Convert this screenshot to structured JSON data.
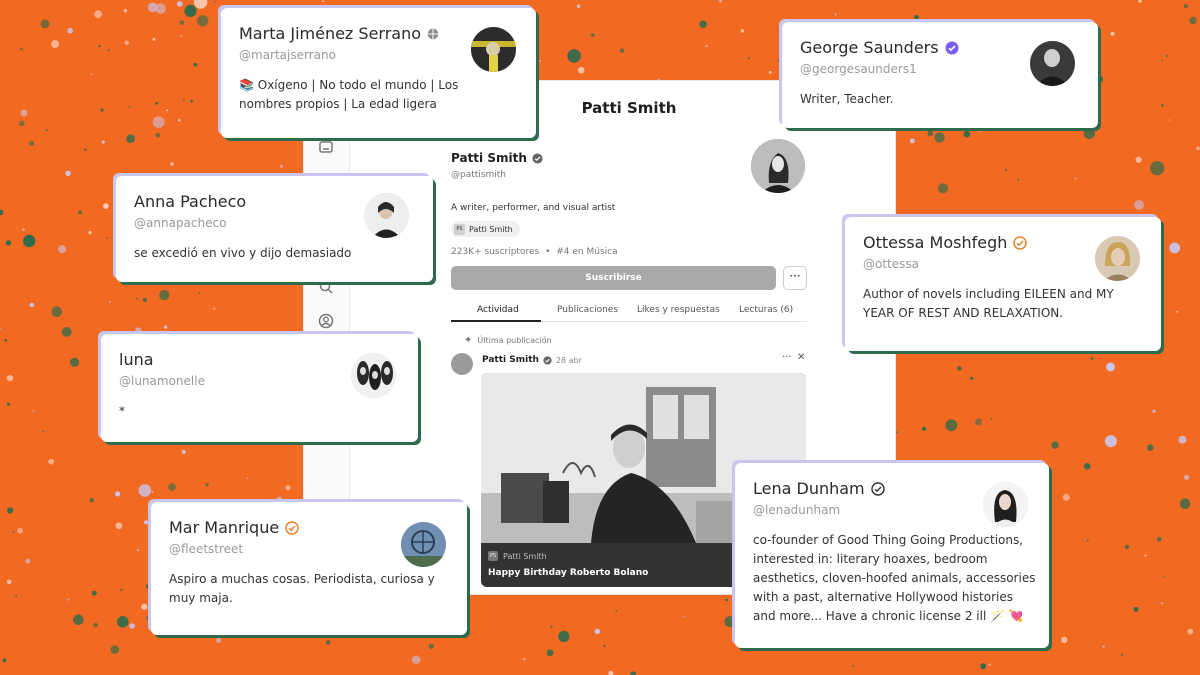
{
  "profile": {
    "title": "Patti Smith",
    "name": "Patti Smith",
    "handle": "@pattismith",
    "bio": "A writer, performer, and visual artist",
    "chip_label": "Patti Smith",
    "chip_initials": "PS",
    "subscribers": "223K+ suscriptores",
    "rank": "#4 en Música",
    "subscribe_label": "Suscribirse",
    "more_label": "···",
    "tabs": [
      "Actividad",
      "Publicaciones",
      "Likes y respuestas",
      "Lecturas (6)"
    ],
    "latest_label": "Última publicación",
    "post": {
      "author": "Patti Smith",
      "date": "28 abr",
      "source_initials": "PS",
      "source": "Patti Smith",
      "title": "Happy Birthday Roberto Bolano"
    }
  },
  "cards": [
    {
      "name": "Marta Jiménez Serrano",
      "handle": "@martajserrano",
      "bio": "📚 Oxígeno | No todo el mundo | Los nombres propios | La edad ligera",
      "badge": "globe-icon"
    },
    {
      "name": "George Saunders",
      "handle": "@georgesaunders1",
      "bio": "Writer, Teacher.",
      "badge": "verified-purple-icon"
    },
    {
      "name": "Anna Pacheco",
      "handle": "@annapacheco",
      "bio": "se excedió en vivo y dijo demasiado",
      "badge": ""
    },
    {
      "name": "Ottessa Moshfegh",
      "handle": "@ottessa",
      "bio": "Author of novels including EILEEN and MY YEAR OF REST AND RELAXATION.",
      "badge": "verified-orange-icon"
    },
    {
      "name": "luna",
      "handle": "@lunamonelle",
      "bio": "*",
      "badge": ""
    },
    {
      "name": "Mar Manrique",
      "handle": "@fleetstreet",
      "bio": "Aspiro a muchas cosas. Periodista, curiosa y muy maja.",
      "badge": "verified-orange-icon"
    },
    {
      "name": "Lena Dunham",
      "handle": "@lenadunham",
      "bio": "co-founder of Good Thing Going Productions, interested in: literary hoaxes, bedroom aesthetics, cloven-hoofed animals, accessories with a past, alternative Hollywood histories and more... Have a chronic license 2 ill 🪄 💘",
      "badge": "verified-outline-icon"
    }
  ],
  "colors": {
    "background": "#f26a22",
    "accent_purple": "#7b5cf0",
    "accent_orange": "#e8832a",
    "card_shadow": "#2e6b4c"
  }
}
